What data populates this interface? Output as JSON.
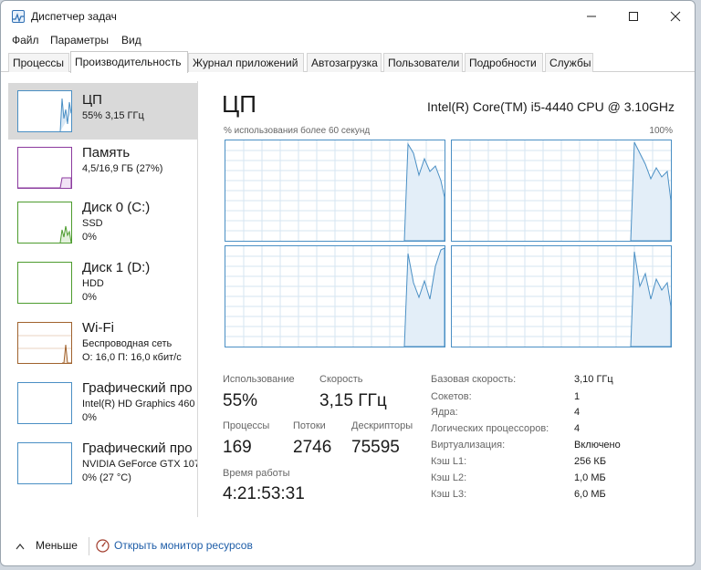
{
  "window": {
    "title": "Диспетчер задач",
    "accent": "#4a8fc4"
  },
  "menu": [
    "Файл",
    "Параметры",
    "Вид"
  ],
  "tabs": [
    "Процессы",
    "Производительность",
    "Журнал приложений",
    "Автозагрузка",
    "Пользователи",
    "Подробности",
    "Службы"
  ],
  "active_tab": "Производительность",
  "sidebar": [
    {
      "name": "ЦП",
      "sub1": "55% 3,15 ГГц",
      "sub2": "",
      "sub3": "",
      "color": "#4a8fc4"
    },
    {
      "name": "Память",
      "sub1": "4,5/16,9 ГБ (27%)",
      "sub2": "",
      "sub3": "",
      "color": "#8b3a9e"
    },
    {
      "name": "Диск 0 (C:)",
      "sub1": "SSD",
      "sub2": "0%",
      "sub3": "",
      "color": "#4d9c2e"
    },
    {
      "name": "Диск 1 (D:)",
      "sub1": "HDD",
      "sub2": "0%",
      "sub3": "",
      "color": "#4d9c2e"
    },
    {
      "name": "Wi-Fi",
      "sub1": "Беспроводная сеть",
      "sub2": "О: 16,0 П: 16,0 кбит/с",
      "sub3": "",
      "color": "#a0622d"
    },
    {
      "name": "Графический про",
      "sub1": "Intel(R) HD Graphics 460",
      "sub2": "0%",
      "sub3": "",
      "color": "#4a8fc4"
    },
    {
      "name": "Графический про",
      "sub1": "NVIDIA GeForce GTX 107",
      "sub2": "0% (27 °C)",
      "sub3": "",
      "color": "#4a8fc4"
    }
  ],
  "main": {
    "title": "ЦП",
    "model": "Intel(R) Core(TM) i5-4440 CPU @ 3.10GHz",
    "graph_left_label": "% использования более 60 секунд",
    "graph_right_label": "100%",
    "cores_usage_fraction": [
      0.55,
      0.55,
      0.55,
      0.55
    ],
    "stats": {
      "usage_label": "Использование",
      "usage_value": "55%",
      "speed_label": "Скорость",
      "speed_value": "3,15 ГГц",
      "processes_label": "Процессы",
      "processes_value": "169",
      "threads_label": "Потоки",
      "threads_value": "2746",
      "handles_label": "Дескрипторы",
      "handles_value": "75595",
      "uptime_label": "Время работы",
      "uptime_value": "4:21:53:31"
    },
    "info": [
      {
        "label": "Базовая скорость:",
        "value": "3,10 ГГц"
      },
      {
        "label": "Сокетов:",
        "value": "1"
      },
      {
        "label": "Ядра:",
        "value": "4"
      },
      {
        "label": "Логических процессоров:",
        "value": "4"
      },
      {
        "label": "Виртуализация:",
        "value": "Включено"
      },
      {
        "label": "Кэш L1:",
        "value": "256 КБ"
      },
      {
        "label": "Кэш L2:",
        "value": "1,0 МБ"
      },
      {
        "label": "Кэш L3:",
        "value": "6,0 МБ"
      }
    ]
  },
  "footer": {
    "fewer_label": "Меньше",
    "monitor_label": "Открыть монитор ресурсов"
  }
}
